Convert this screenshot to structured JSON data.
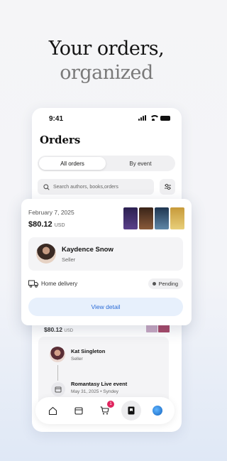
{
  "headline": {
    "line1": "Your orders,",
    "line2": "organized"
  },
  "status_bar": {
    "time": "9:41"
  },
  "page": {
    "title": "Orders"
  },
  "segments": {
    "all_orders": "All orders",
    "by_event": "By event"
  },
  "search": {
    "placeholder": "Search authors, books,orders"
  },
  "order_card": {
    "date": "February 7, 2025",
    "price": "$80.12",
    "currency": "USD",
    "seller_name": "Kaydence Snow",
    "seller_role": "Seller",
    "delivery": "Home delivery",
    "status": "Pending",
    "detail_button": "View detail",
    "book_colors": [
      "#3b2c5e",
      "#5a3a2a",
      "#2e4a6a",
      "#c9a24a"
    ]
  },
  "order2": {
    "price": "$80.12",
    "currency": "USD",
    "seller_name": "Kat Singleton",
    "seller_role": "Seller",
    "event_name": "Romantasy Live event",
    "event_meta": "May 31, 2025 • Syndey"
  },
  "tabbar": {
    "cart_badge": "1",
    "items": [
      "home-icon",
      "calendar-icon",
      "cart-icon",
      "orders-icon",
      "profile-icon"
    ]
  }
}
